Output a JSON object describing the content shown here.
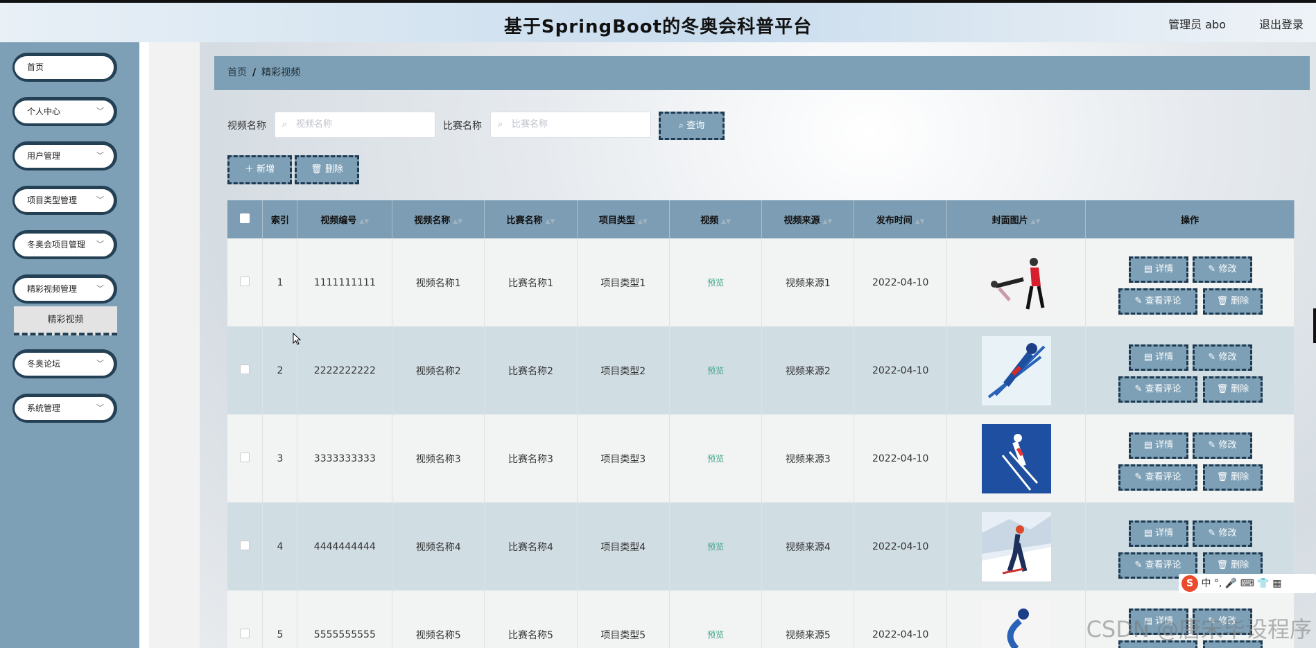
{
  "header": {
    "title": "基于SpringBoot的冬奥会科普平台",
    "user": "管理员 abo",
    "logout": "退出登录"
  },
  "sidebar": {
    "items": [
      {
        "label": "首页",
        "has_arrow": false
      },
      {
        "label": "个人中心",
        "has_arrow": true
      },
      {
        "label": "用户管理",
        "has_arrow": true
      },
      {
        "label": "项目类型管理",
        "has_arrow": true
      },
      {
        "label": "冬奥会项目管理",
        "has_arrow": true
      },
      {
        "label": "精彩视频管理",
        "has_arrow": true
      },
      {
        "label": "冬奥论坛",
        "has_arrow": true
      },
      {
        "label": "系统管理",
        "has_arrow": true
      }
    ],
    "active_submenu": "精彩视频"
  },
  "breadcrumb": {
    "home": "首页",
    "sep": "/",
    "current": "精彩视频"
  },
  "search": {
    "video_name_label": "视频名称",
    "video_name_placeholder": "视频名称",
    "match_name_label": "比赛名称",
    "match_name_placeholder": "比赛名称",
    "query_button": "查询"
  },
  "toolbar": {
    "add_button": "新增",
    "delete_button": "删除"
  },
  "table": {
    "columns": [
      "索引",
      "视频编号",
      "视频名称",
      "比赛名称",
      "项目类型",
      "视频",
      "视频来源",
      "发布时间",
      "封面图片",
      "操作"
    ],
    "rows": [
      {
        "index": "1",
        "code": "1111111111",
        "name": "视频名称1",
        "match": "比赛名称1",
        "type": "项目类型1",
        "video": "预览",
        "source": "视频来源1",
        "date": "2022-04-10"
      },
      {
        "index": "2",
        "code": "2222222222",
        "name": "视频名称2",
        "match": "比赛名称2",
        "type": "项目类型2",
        "video": "预览",
        "source": "视频来源2",
        "date": "2022-04-10"
      },
      {
        "index": "3",
        "code": "3333333333",
        "name": "视频名称3",
        "match": "比赛名称3",
        "type": "项目类型3",
        "video": "预览",
        "source": "视频来源3",
        "date": "2022-04-10"
      },
      {
        "index": "4",
        "code": "4444444444",
        "name": "视频名称4",
        "match": "比赛名称4",
        "type": "项目类型4",
        "video": "预览",
        "source": "视频来源4",
        "date": "2022-04-10"
      },
      {
        "index": "5",
        "code": "5555555555",
        "name": "视频名称5",
        "match": "比赛名称5",
        "type": "项目类型5",
        "video": "预览",
        "source": "视频来源5",
        "date": "2022-04-10"
      }
    ],
    "actions": {
      "detail": "详情",
      "edit": "修改",
      "comments": "查看评论",
      "delete": "删除"
    }
  },
  "watermark": "CSDN @唐宋毕设程序",
  "ime": {
    "mode": "中"
  },
  "colors": {
    "accent": "#7da0b6",
    "dark": "#244055",
    "preview": "#41a487"
  }
}
